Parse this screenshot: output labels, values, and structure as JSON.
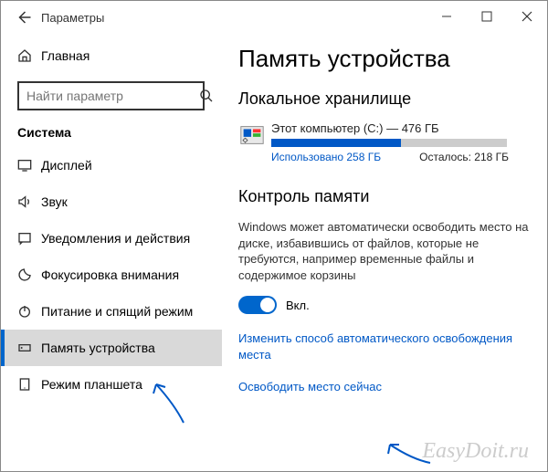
{
  "app_title": "Параметры",
  "home_label": "Главная",
  "search_placeholder": "Найти параметр",
  "side_section": "Система",
  "nav": [
    {
      "label": "Дисплей"
    },
    {
      "label": "Звук"
    },
    {
      "label": "Уведомления и действия"
    },
    {
      "label": "Фокусировка внимания"
    },
    {
      "label": "Питание и спящий режим"
    },
    {
      "label": "Память устройства"
    },
    {
      "label": "Режим планшета"
    }
  ],
  "page_title": "Память устройства",
  "section_local": "Локальное хранилище",
  "drive_name": "Этот компьютер (C:) — 476 ГБ",
  "used_label": "Использовано 258 ГБ",
  "remain_label": "Осталось: 218 ГБ",
  "section_sense": "Контроль памяти",
  "sense_desc": "Windows может автоматически освободить место на диске, избавившись от файлов, которые не требуются, например временные файлы и содержимое корзины",
  "toggle_label": "Вкл.",
  "link_configure": "Изменить способ автоматического освобождения места",
  "link_freenow": "Освободить место сейчас",
  "watermark": "EasyDoit.ru"
}
